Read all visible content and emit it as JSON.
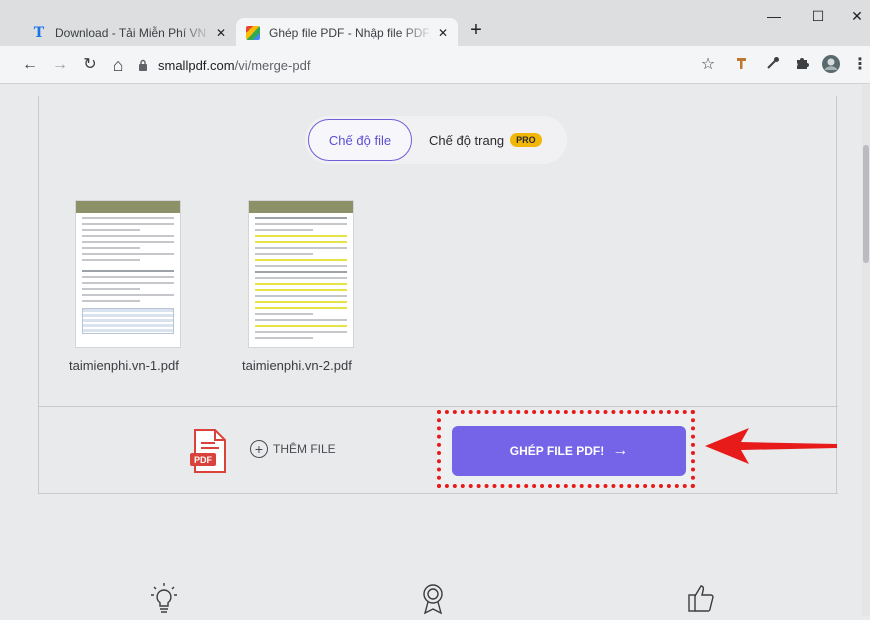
{
  "browser": {
    "tabs": [
      {
        "title": "Download - Tải Miễn Phí VN - Pl",
        "close": "✕",
        "favicon": "T"
      },
      {
        "title": "Ghép file PDF - Nhập file PDF trự",
        "close": "✕"
      }
    ],
    "new_tab": "+",
    "window_controls": {
      "minimize": "—",
      "maximize": "☐",
      "close": "✕"
    },
    "nav": {
      "back": "←",
      "forward": "→",
      "reload": "↻",
      "home": "⌂"
    },
    "url": {
      "host": "smallpdf.com",
      "path": "/vi/merge-pdf"
    },
    "bookmark_star": "☆"
  },
  "mode_toggle": {
    "file_mode": "Chế độ file",
    "page_mode": "Chế độ trang",
    "pro_badge": "PRO"
  },
  "files": [
    {
      "name": "taimienphi.vn-1.pdf"
    },
    {
      "name": "taimienphi.vn-2.pdf"
    }
  ],
  "actions": {
    "add_file": "THÊM FILE",
    "add_file_plus": "+",
    "merge": "GHÉP FILE PDF!",
    "merge_arrow": "→",
    "pdf_icon_text": "PDF"
  },
  "colors": {
    "accent": "#7563e8",
    "highlight": "#e81b1b",
    "pro": "#f2b705"
  },
  "features": [
    {
      "icon": "lightbulb-icon"
    },
    {
      "icon": "award-icon"
    },
    {
      "icon": "thumbs-up-icon"
    }
  ]
}
